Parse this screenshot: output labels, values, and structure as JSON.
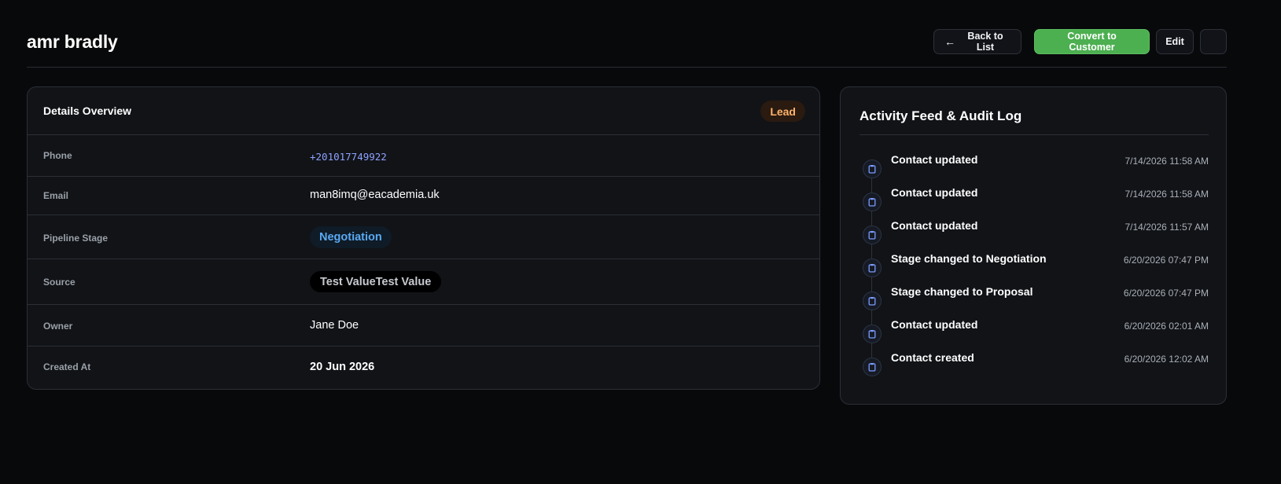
{
  "header": {
    "title": "amr bradly",
    "back_label": "Back to List",
    "convert_label": "Convert to Customer",
    "edit_label": "Edit"
  },
  "details": {
    "title": "Details Overview",
    "badge": "Lead",
    "rows": [
      {
        "label": "Phone",
        "value": "+201017749922"
      },
      {
        "label": "Email",
        "value": "man8imq@eacademia.uk"
      },
      {
        "label": "Pipeline Stage",
        "value": "Negotiation"
      },
      {
        "label": "Source",
        "value": "Test ValueTest Value"
      },
      {
        "label": "Owner",
        "value": "Jane Doe"
      },
      {
        "label": "Created At",
        "value": "20 Jun 2026"
      }
    ]
  },
  "activity": {
    "title": "Activity Feed & Audit Log",
    "items": [
      {
        "text": "Contact updated",
        "time": "7/14/2026 11:58 AM",
        "icon": "clipboard-icon"
      },
      {
        "text": "Contact updated",
        "time": "7/14/2026 11:58 AM",
        "icon": "clipboard-icon"
      },
      {
        "text": "Contact updated",
        "time": "7/14/2026 11:57 AM",
        "icon": "clipboard-icon"
      },
      {
        "text": "Stage changed to Negotiation",
        "time": "6/20/2026 07:47 PM",
        "icon": "clipboard-icon"
      },
      {
        "text": "Stage changed to Proposal",
        "time": "6/20/2026 07:47 PM",
        "icon": "clipboard-icon"
      },
      {
        "text": "Contact updated",
        "time": "6/20/2026 02:01 AM",
        "icon": "clipboard-icon"
      },
      {
        "text": "Contact created",
        "time": "6/20/2026 12:02 AM",
        "icon": "clipboard-icon"
      }
    ]
  },
  "colors": {
    "background": "#08090b",
    "card": "#111317",
    "accent_green": "#4caf50",
    "lead_badge": "#ffb26b",
    "stage_blue": "#5aa9f2",
    "phone_link": "#8ea2ff"
  }
}
